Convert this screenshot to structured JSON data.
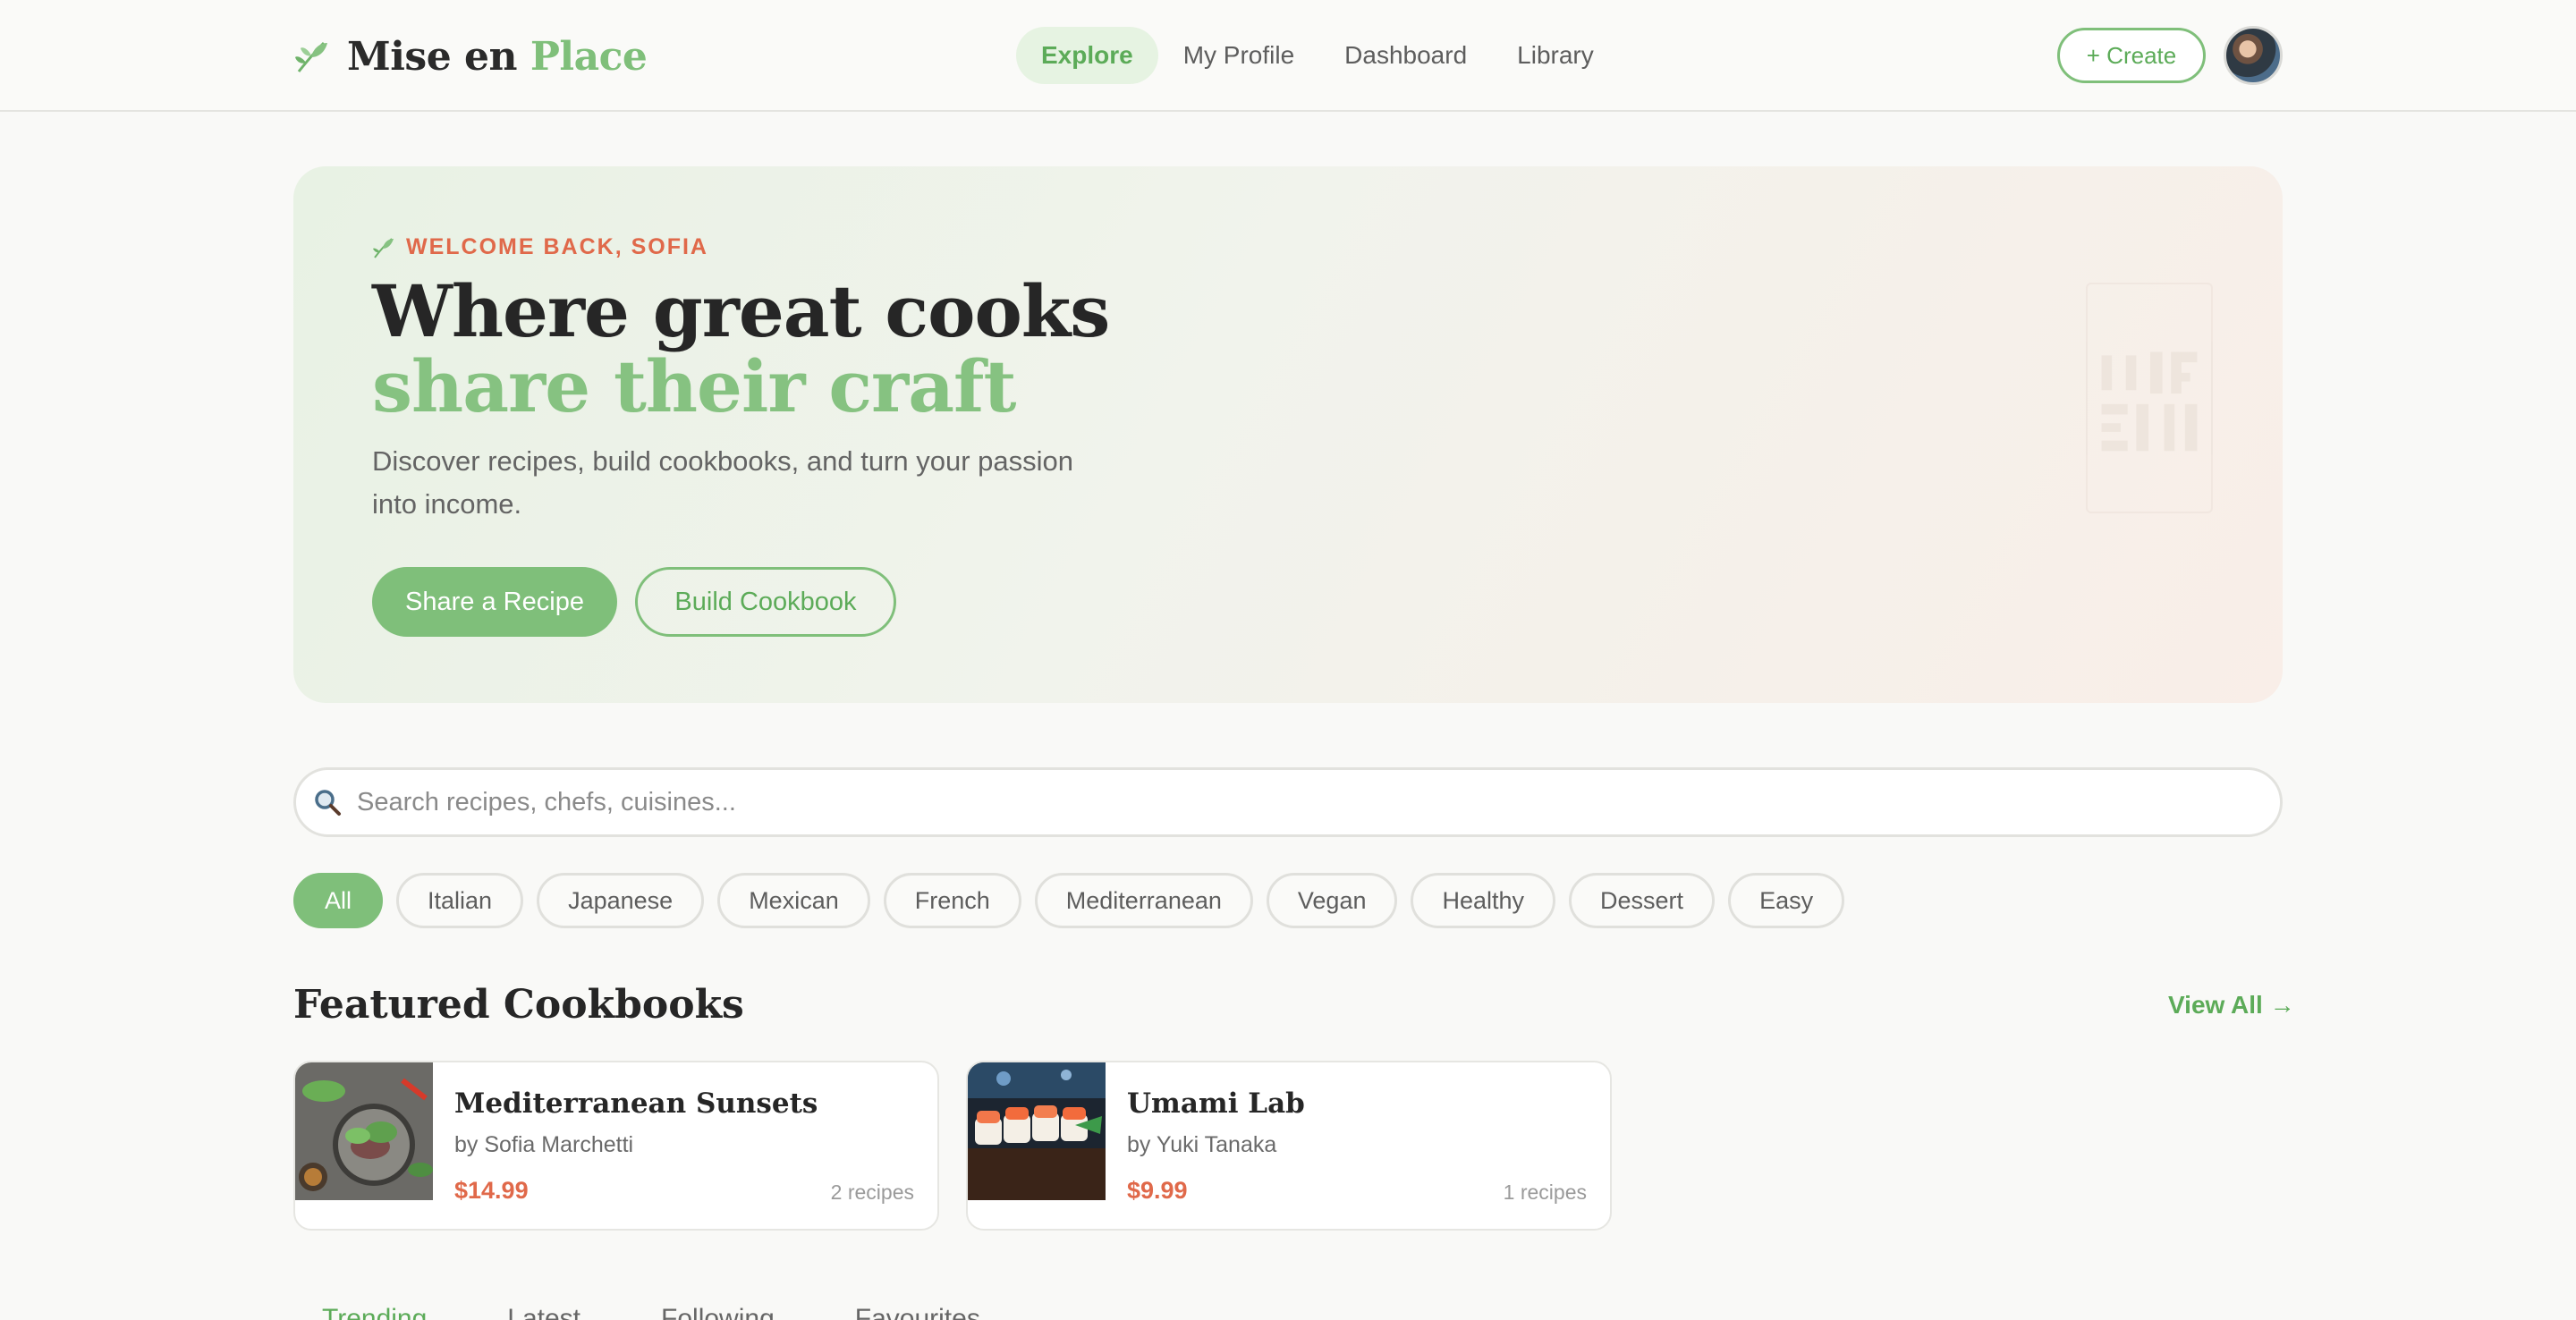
{
  "brand": {
    "name_part1": "Mise en",
    "name_part2": "Place"
  },
  "nav": {
    "items": [
      {
        "label": "Explore",
        "active": true
      },
      {
        "label": "My Profile"
      },
      {
        "label": "Dashboard"
      },
      {
        "label": "Library"
      }
    ],
    "create_label": "+ Create"
  },
  "hero": {
    "eyebrow": "WELCOME BACK, SOFIA",
    "title_line1": "Where great cooks",
    "title_line2": "share their craft",
    "subtitle": "Discover recipes, build cookbooks, and turn your passion into income.",
    "primary_cta": "Share a Recipe",
    "secondary_cta": "Build Cookbook"
  },
  "search": {
    "placeholder": "Search recipes, chefs, cuisines..."
  },
  "filters": {
    "chips": [
      "All",
      "Italian",
      "Japanese",
      "Mexican",
      "French",
      "Mediterranean",
      "Vegan",
      "Healthy",
      "Dessert",
      "Easy"
    ],
    "active": "All"
  },
  "featured": {
    "title": "Featured Cookbooks",
    "view_all": "View All →",
    "cards": [
      {
        "title": "Mediterranean Sunsets",
        "author": "by Sofia Marchetti",
        "price": "$14.99",
        "count": "2 recipes"
      },
      {
        "title": "Umami Lab",
        "author": "by Yuki Tanaka",
        "price": "$9.99",
        "count": "1 recipes"
      }
    ]
  },
  "bottom_tabs": [
    "Trending",
    "Latest",
    "Following",
    "Favourites"
  ],
  "colors": {
    "accent": "#7fbf7a",
    "accent_dark": "#5cab58",
    "price": "#e0694a",
    "background": "#f9f9f7"
  }
}
